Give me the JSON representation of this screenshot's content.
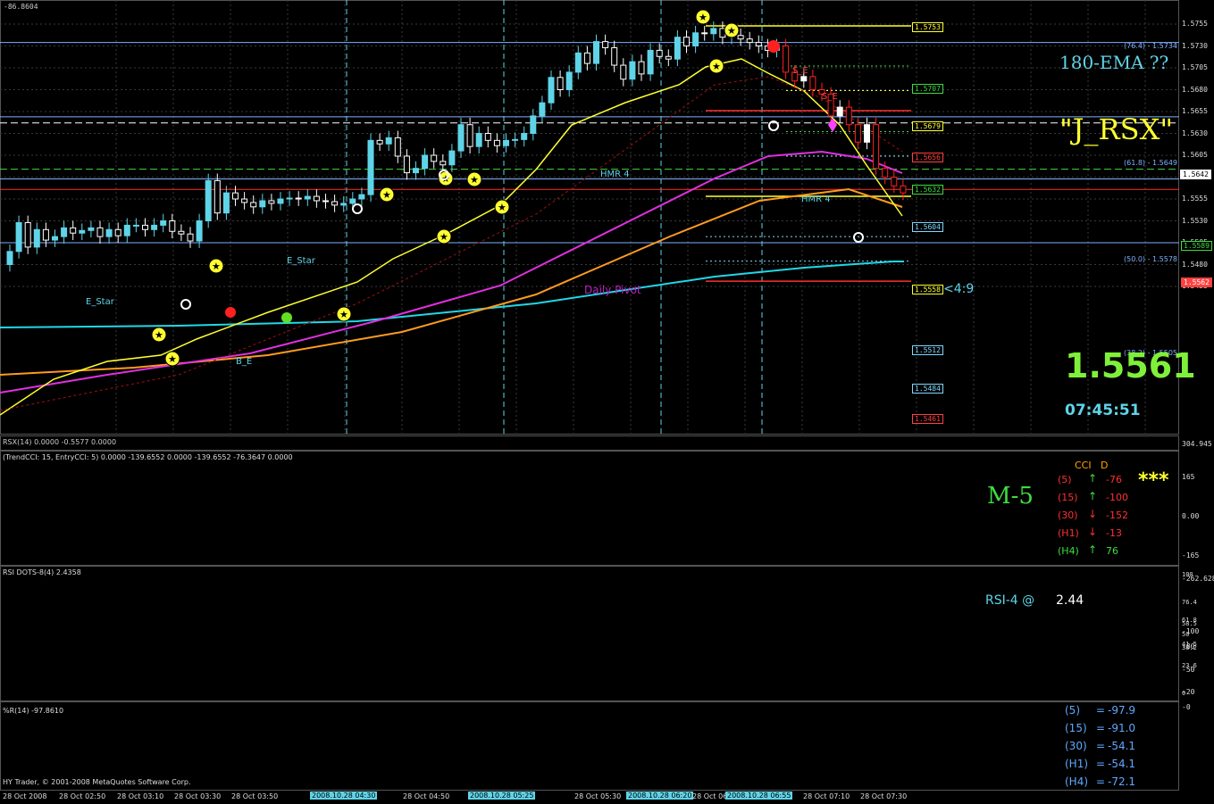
{
  "main": {
    "corner_value": "-86.8604",
    "price_scale": [
      "1.5755",
      "1.5730",
      "1.5705",
      "1.5680",
      "1.5655",
      "1.5630",
      "1.5605",
      "1.5580",
      "1.5555",
      "1.5530",
      "1.5505",
      "1.5480",
      "1.5455"
    ],
    "current_price_tag": "1.5642",
    "tag_1": "1.5589",
    "tag_2": "1.5562",
    "levels": [
      "1.5753",
      "1.5707",
      "1.5679",
      "1.5656",
      "1.5632",
      "1.5604",
      "1.5558",
      "1.5512",
      "1.5484",
      "1.5461"
    ],
    "fib_76": "(76.4) - 1.5734",
    "fib_61": "(61.8) - 1.5649",
    "fib_50": "(50.0) - 1.5578",
    "fib_38": "(38.2) - 1.5505",
    "ema_text": "180-EMA ??",
    "jrsx_text": "\"J_RSX\"",
    "pivot_text": "Daily Pivot",
    "arrow_text": "<4:9",
    "big_price": "1.5561",
    "clock": "07:45:51",
    "annotations": {
      "estar1": "E_Star",
      "estar2": "E_Star",
      "hmr1": "HMR 4",
      "hmr2": "HMR 4",
      "se1": "S_E",
      "se2": "S_E",
      "bull": "B_E"
    }
  },
  "strip": {
    "label": "RSX(14) 0.0000 -0.5577 0.0000"
  },
  "cci": {
    "title": "(TrendCCI: 15, EntryCCI: 5) 0.0000 -139.6552 0.0000 -139.6552 -76.3647 0.0000",
    "scale": [
      "304.945",
      "165",
      "0.00",
      "-165",
      "-262.628"
    ],
    "m5": "M-5",
    "head_cci": "CCI",
    "head_d": "D",
    "stars": "***",
    "rows": [
      {
        "tf": "(5)",
        "val": "-76",
        "color": "#ff3030",
        "arrow": "up"
      },
      {
        "tf": "(15)",
        "val": "-100",
        "color": "#ff3030",
        "arrow": "up"
      },
      {
        "tf": "(30)",
        "val": "-152",
        "color": "#ff3030",
        "arrow": "down"
      },
      {
        "tf": "(H1)",
        "val": "-13",
        "color": "#ff3030",
        "arrow": "down"
      },
      {
        "tf": "(H4)",
        "val": "76",
        "color": "#3fdc3f",
        "arrow": "up"
      }
    ]
  },
  "rsi": {
    "title": "RSI DOTS-8(4) 2.4358",
    "scale": [
      "100",
      "76.4",
      "61.8",
      "58.5",
      "50",
      "41.5",
      "38.2",
      "23.6",
      "0"
    ],
    "label": "RSI-4 @",
    "value": "2.44"
  },
  "wr": {
    "title": "%R(14) -97.8610",
    "scale": [
      "-0",
      "-20",
      "-50",
      "-80",
      "-100"
    ],
    "rows": [
      {
        "tf": "(5)",
        "val": "-97.9"
      },
      {
        "tf": "(15)",
        "val": "-91.0"
      },
      {
        "tf": "(30)",
        "val": "-54.1"
      },
      {
        "tf": "(H1)",
        "val": "-54.1"
      },
      {
        "tf": "(H4)",
        "val": "-72.1"
      }
    ],
    "eq": "=",
    "copyright": "HY Trader, © 2001-2008 MetaQuotes Software Corp."
  },
  "dates": [
    "28 Oct 2008",
    "28 Oct 02:50",
    "28 Oct 03:10",
    "28 Oct 03:30",
    "28 Oct 03:50",
    "28 Oct 04:50",
    "28 Oct 05:30",
    "28 Oct 05:50",
    "28 Oct 06",
    "28 Oct 07:10",
    "28 Oct 07:30"
  ],
  "date_highlights": [
    "2008.10.28 04:30",
    "2008.10.28 05:25",
    "2008.10.28 06:20",
    "2008.10.28 06:55"
  ]
}
